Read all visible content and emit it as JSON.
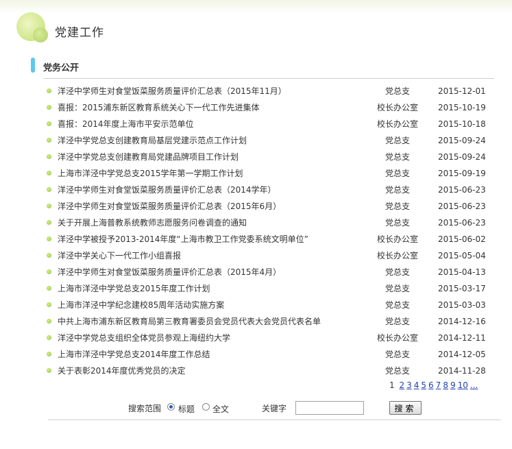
{
  "header": {
    "title": "党建工作"
  },
  "section": {
    "title": "党务公开"
  },
  "items": [
    {
      "title": "洋泾中学师生对食堂饭菜服务质量评价汇总表（2015年11月）",
      "dept": "党总支",
      "date": "2015-12-01"
    },
    {
      "title": "喜报：2015浦东新区教育系统关心下一代工作先进集体",
      "dept": "校长办公室",
      "date": "2015-10-19"
    },
    {
      "title": "喜报：2014年度上海市平安示范单位",
      "dept": "校长办公室",
      "date": "2015-10-18"
    },
    {
      "title": "洋泾中学党总支创建教育局基层党建示范点工作计划",
      "dept": "党总支",
      "date": "2015-09-24"
    },
    {
      "title": "洋泾中学党总支创建教育局党建品牌项目工作计划",
      "dept": "党总支",
      "date": "2015-09-24"
    },
    {
      "title": "上海市洋泾中学党总支2015学年第一学期工作计划",
      "dept": "党总支",
      "date": "2015-09-19"
    },
    {
      "title": "洋泾中学师生对食堂饭菜服务质量评价汇总表（2014学年）",
      "dept": "党总支",
      "date": "2015-06-23"
    },
    {
      "title": "洋泾中学师生对食堂饭菜服务质量评价汇总表（2015年6月）",
      "dept": "党总支",
      "date": "2015-06-23"
    },
    {
      "title": "关于开展上海普教系统教师志愿服务问卷调查的通知",
      "dept": "党总支",
      "date": "2015-06-23"
    },
    {
      "title": "洋泾中学被授予2013-2014年度“上海市教卫工作党委系统文明单位”",
      "dept": "校长办公室",
      "date": "2015-06-02"
    },
    {
      "title": "洋泾中学关心下一代工作小组喜报",
      "dept": "校长办公室",
      "date": "2015-05-04"
    },
    {
      "title": "洋泾中学师生对食堂饭菜服务质量评价汇总表（2015年4月）",
      "dept": "党总支",
      "date": "2015-04-13"
    },
    {
      "title": "上海市洋泾中学党总支2015年度工作计划",
      "dept": "党总支",
      "date": "2015-03-17"
    },
    {
      "title": "上海市洋泾中学纪念建校85周年活动实施方案",
      "dept": "党总支",
      "date": "2015-03-03"
    },
    {
      "title": "中共上海市浦东新区教育局第三教育署委员会党员代表大会党员代表名单",
      "dept": "党总支",
      "date": "2014-12-16"
    },
    {
      "title": "洋泾中学党总支组织全体党员参观上海纽约大学",
      "dept": "校长办公室",
      "date": "2014-12-11"
    },
    {
      "title": "上海市洋泾中学党总支2014年度工作总结",
      "dept": "党总支",
      "date": "2014-12-05"
    },
    {
      "title": "关于表彰2014年度优秀党员的决定",
      "dept": "党总支",
      "date": "2014-11-28"
    }
  ],
  "pagination": {
    "current": "1",
    "pages": [
      "2",
      "3",
      "4",
      "5",
      "6",
      "7",
      "8",
      "9",
      "10"
    ],
    "more": "..."
  },
  "search": {
    "scope_label": "搜索范围",
    "option_title": "标题",
    "option_fulltext": "全文",
    "selected": "标题",
    "keyword_label": "关键字",
    "keyword_value": "",
    "button_label": "搜索"
  },
  "colors": {
    "accent_bar": "#5ec8ee",
    "bullet": "#8cc63f",
    "link": "#1f3fb0"
  }
}
